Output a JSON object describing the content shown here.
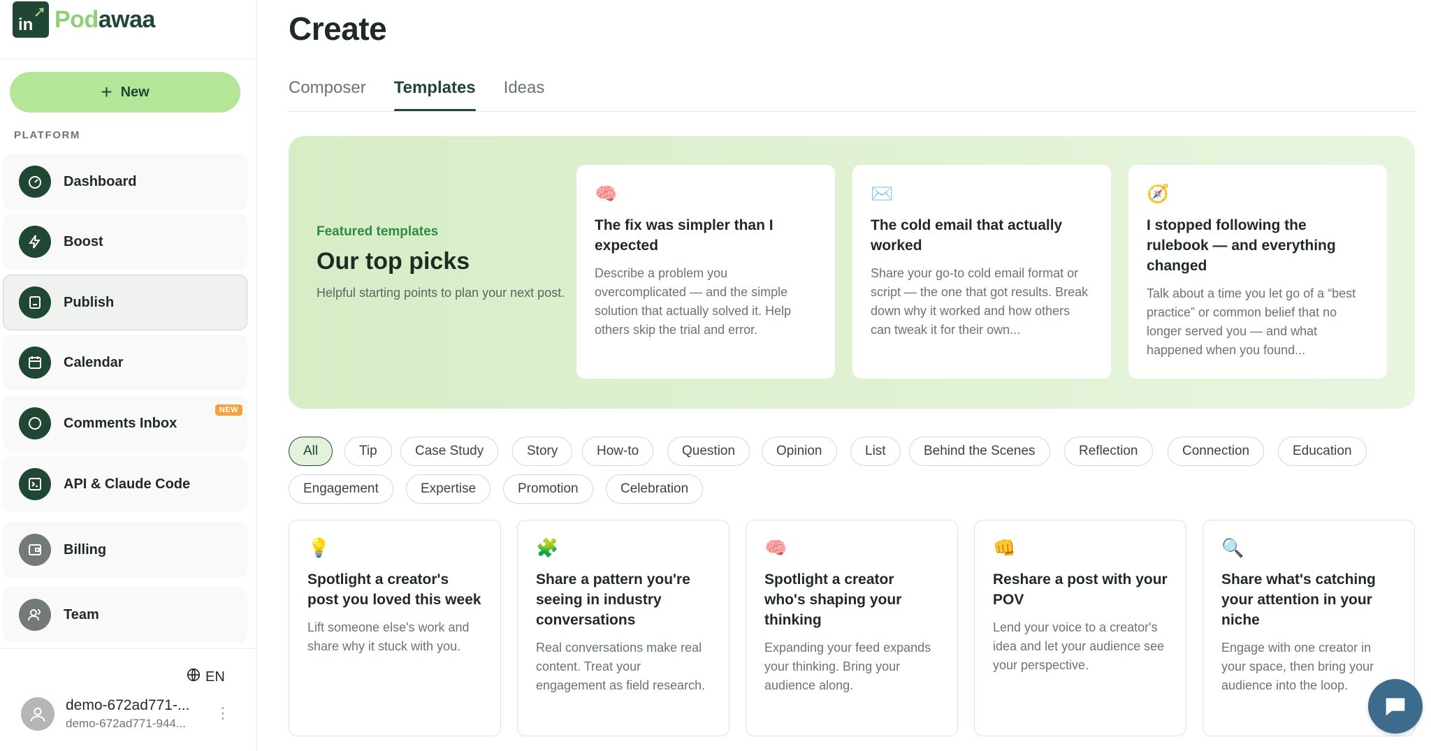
{
  "brand": {
    "logo_mark": "in",
    "name_part1": "Pod",
    "name_part2": "awaa"
  },
  "sidebar": {
    "new_label": "New",
    "section_label": "PLATFORM",
    "items": [
      {
        "label": "Dashboard",
        "icon": "gauge-icon"
      },
      {
        "label": "Boost",
        "icon": "lightning-icon"
      },
      {
        "label": "Publish",
        "icon": "publish-icon",
        "active": true
      },
      {
        "label": "Calendar",
        "icon": "calendar-icon"
      },
      {
        "label": "Comments Inbox",
        "icon": "chat-icon",
        "badge": "NEW"
      },
      {
        "label": "API & Claude Code",
        "icon": "terminal-icon"
      },
      {
        "label": "Billing",
        "icon": "wallet-icon"
      },
      {
        "label": "Team",
        "icon": "team-icon"
      }
    ],
    "language": "EN",
    "user": {
      "name": "demo-672ad771-...",
      "email": "demo-672ad771-944..."
    }
  },
  "main": {
    "title": "Create",
    "tabs": [
      {
        "label": "Composer"
      },
      {
        "label": "Templates",
        "active": true
      },
      {
        "label": "Ideas"
      }
    ],
    "featured": {
      "eyebrow": "Featured templates",
      "title": "Our top picks",
      "subtitle": "Helpful starting points to plan your next post.",
      "cards": [
        {
          "emoji": "🧠",
          "title": "The fix was simpler than I expected",
          "description": "Describe a problem you overcomplicated — and the simple solution that actually solved it. Help others skip the trial and error."
        },
        {
          "emoji": "✉️",
          "title": "The cold email that actually worked",
          "description": "Share your go-to cold email format or script — the one that got results. Break down why it worked and how others can tweak it for their own..."
        },
        {
          "emoji": "🧭",
          "title": "I stopped following the rulebook — and everything changed",
          "description": "Talk about a time you let go of a “best practice” or common belief that no longer served you — and what happened when you found..."
        }
      ]
    },
    "filters": [
      "All",
      "Tip",
      "Case Study",
      "Story",
      "How-to",
      "Question",
      "Opinion",
      "List",
      "Behind the Scenes",
      "Reflection",
      "Connection",
      "Education",
      "Engagement",
      "Expertise",
      "Promotion",
      "Celebration"
    ],
    "active_filter": "All",
    "templates": [
      {
        "emoji": "💡",
        "title": "Spotlight a creator's post you loved this week",
        "description": "Lift someone else's work and share why it stuck with you."
      },
      {
        "emoji": "🧩",
        "title": "Share a pattern you're seeing in industry conversations",
        "description": "Real conversations make real content. Treat your engagement as field research."
      },
      {
        "emoji": "🧠",
        "title": "Spotlight a creator who's shaping your thinking",
        "description": "Expanding your feed expands your thinking. Bring your audience along."
      },
      {
        "emoji": "👊",
        "title": "Reshare a post with your POV",
        "description": "Lend your voice to a creator's idea and let your audience see your perspective."
      },
      {
        "emoji": "🔍",
        "title": "Share what's catching your attention in your niche",
        "description": "Engage with one creator in your space, then bring your audience into the loop."
      }
    ]
  },
  "colors": {
    "brand_dark": "#1f4733",
    "brand_light": "#b4e598",
    "accent_badge": "#f4a23a"
  }
}
